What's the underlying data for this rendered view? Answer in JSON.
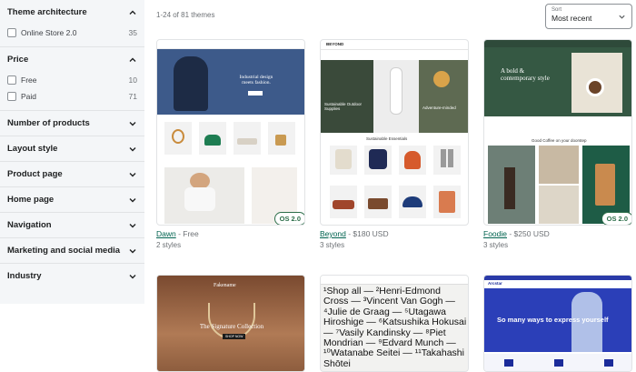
{
  "filters": [
    {
      "title": "Theme architecture",
      "expanded": true,
      "options": [
        {
          "label": "Online Store 2.0",
          "count": "35"
        }
      ]
    },
    {
      "title": "Price",
      "expanded": true,
      "options": [
        {
          "label": "Free",
          "count": "10"
        },
        {
          "label": "Paid",
          "count": "71"
        }
      ]
    },
    {
      "title": "Number of products",
      "expanded": false
    },
    {
      "title": "Layout style",
      "expanded": false
    },
    {
      "title": "Product page",
      "expanded": false
    },
    {
      "title": "Home page",
      "expanded": false
    },
    {
      "title": "Navigation",
      "expanded": false
    },
    {
      "title": "Marketing and social media",
      "expanded": false
    },
    {
      "title": "Industry",
      "expanded": false
    }
  ],
  "results": {
    "count_text": "1-24 of 81 themes"
  },
  "sort": {
    "label": "Sort",
    "value": "Most recent"
  },
  "themes": [
    {
      "name": "Dawn",
      "price": " - Free",
      "styles": "2 styles",
      "badge": "OS 2.0",
      "preview": {
        "hero_text": "Industrial design meets fashion."
      }
    },
    {
      "name": "Beyond",
      "price": " - $180 USD",
      "styles": "3 styles",
      "badge": "",
      "preview": {
        "brand": "BEYOND",
        "hero_left": "Sustainable Outdoor Supplies",
        "hero_right": "Adventure-minded",
        "section": "Sustainable Essentials"
      }
    },
    {
      "name": "Foodie",
      "price": " - $250 USD",
      "styles": "3 styles",
      "badge": "OS 2.0",
      "preview": {
        "hero_text": "A bold & contemporary style",
        "section": "Good Coffee on your doorstep"
      }
    },
    {
      "name": "",
      "price": "",
      "styles": "",
      "badge": "",
      "preview": {
        "brand": "Fakename",
        "hero_text": "The Signature Collection",
        "button": "SHOP NOW"
      }
    },
    {
      "name": "",
      "price": "",
      "styles": "",
      "badge": "",
      "preview": {
        "text": "¹Shop all — ²Henri-Edmond Cross — ³Vincent Van Gogh — ⁴Julie de Graag — ⁵Utagawa Hiroshige — ⁶Katsushika Hokusai — ⁷Vasily Kandinsky — ⁸Piet Mondrian — ⁹Edvard Munch — ¹⁰Watanabe Seitei — ¹¹Takahashi Shōtei"
      }
    },
    {
      "name": "",
      "price": "",
      "styles": "",
      "badge": "",
      "preview": {
        "brand": "Arcstar",
        "hero_text": "So many ways to express yourself"
      }
    }
  ]
}
